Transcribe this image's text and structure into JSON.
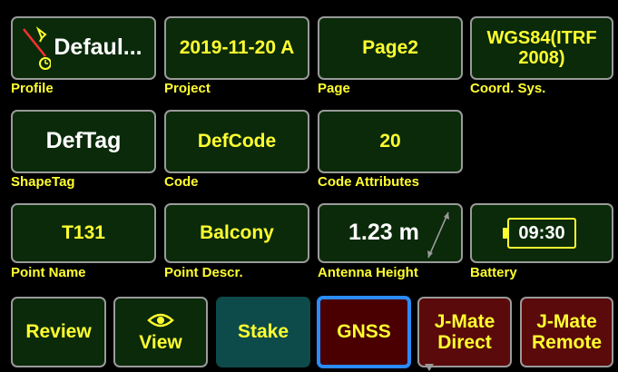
{
  "row1": {
    "profile": {
      "value": "Defaul...",
      "label": "Profile"
    },
    "project": {
      "value": "2019-11-20 A",
      "label": "Project"
    },
    "page": {
      "value": "Page2",
      "label": "Page"
    },
    "coord": {
      "value": "WGS84(ITRF 2008)",
      "label": "Coord. Sys."
    }
  },
  "row2": {
    "shapetag": {
      "value": "DefTag",
      "label": "ShapeTag"
    },
    "code": {
      "value": "DefCode",
      "label": "Code"
    },
    "attributes": {
      "value": "20",
      "label": "Code Attributes"
    }
  },
  "row3": {
    "point_name": {
      "value": "T131",
      "label": "Point Name"
    },
    "point_descr": {
      "value": "Balcony",
      "label": "Point Descr."
    },
    "antenna": {
      "value": "1.23 m",
      "label": "Antenna Height"
    },
    "battery": {
      "value": "09:30",
      "label": "Battery"
    }
  },
  "buttons": {
    "review": "Review",
    "view": "View",
    "stake": "Stake",
    "gnss": "GNSS",
    "jmate_direct": "J-Mate Direct",
    "jmate_remote": "J-Mate Remote"
  },
  "icons": {
    "profile": "surveyor-pole-icon",
    "view": "eye-icon",
    "antenna": "diagonal-arrow-icon",
    "battery": "battery-icon",
    "dropdown": "triangle-down-icon"
  },
  "colors": {
    "tile_bg": "#0a2a0a",
    "value_yellow": "#ffff30",
    "stake_bg": "#0d4a4a",
    "gnss_bg": "#4a0000",
    "jmate_bg": "#5a0a0a",
    "selection_blue": "#2a8cff"
  }
}
